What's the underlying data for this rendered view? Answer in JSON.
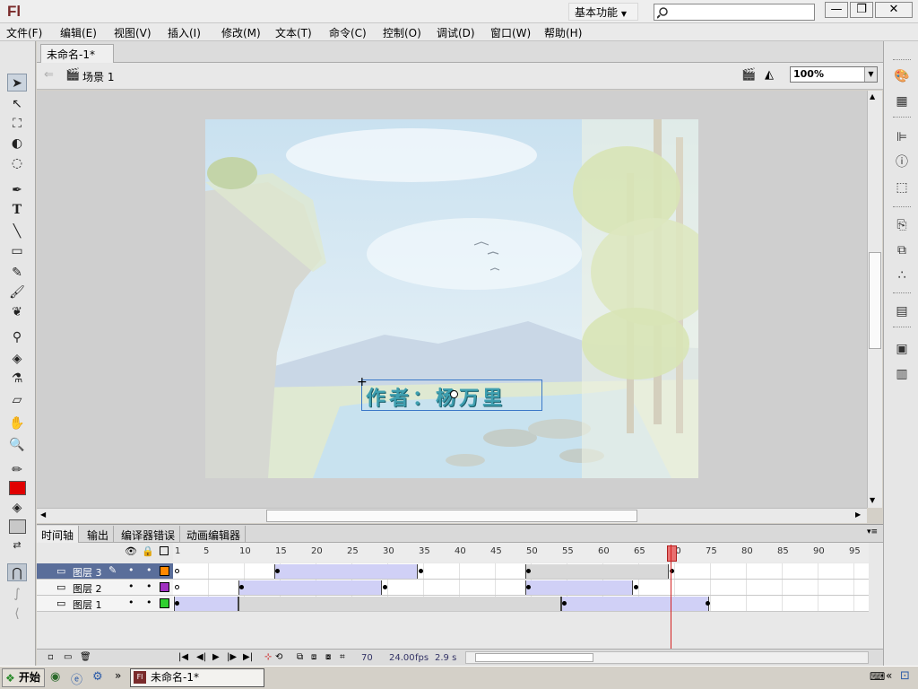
{
  "app": {
    "logo": "Fl",
    "workspace": "基本功能",
    "title": "未命名-1*"
  },
  "menu": [
    "文件(F)",
    "编辑(E)",
    "视图(V)",
    "插入(I)",
    "修改(M)",
    "文本(T)",
    "命令(C)",
    "控制(O)",
    "调试(D)",
    "窗口(W)",
    "帮助(H)"
  ],
  "scene": {
    "label": "场景 1",
    "zoom": "100%"
  },
  "stage": {
    "text": "作者：杨万里"
  },
  "timeline": {
    "tabs": [
      "时间轴",
      "输出",
      "编译器错误",
      "动画编辑器"
    ],
    "frame_numbers": [
      "1",
      "5",
      "10",
      "15",
      "20",
      "25",
      "30",
      "35",
      "40",
      "45",
      "50",
      "55",
      "60",
      "65",
      "70",
      "75",
      "80",
      "85",
      "90",
      "95"
    ],
    "layers": [
      {
        "name": "图层 3",
        "color": "#ff8800"
      },
      {
        "name": "图层 2",
        "color": "#a030c0"
      },
      {
        "name": "图层 1",
        "color": "#30d030"
      }
    ],
    "current_frame": "70",
    "fps": "24.00",
    "fps_unit": "fps",
    "time": "2.9 s"
  },
  "taskbar": {
    "start": "开始",
    "item": "未命名-1*"
  }
}
